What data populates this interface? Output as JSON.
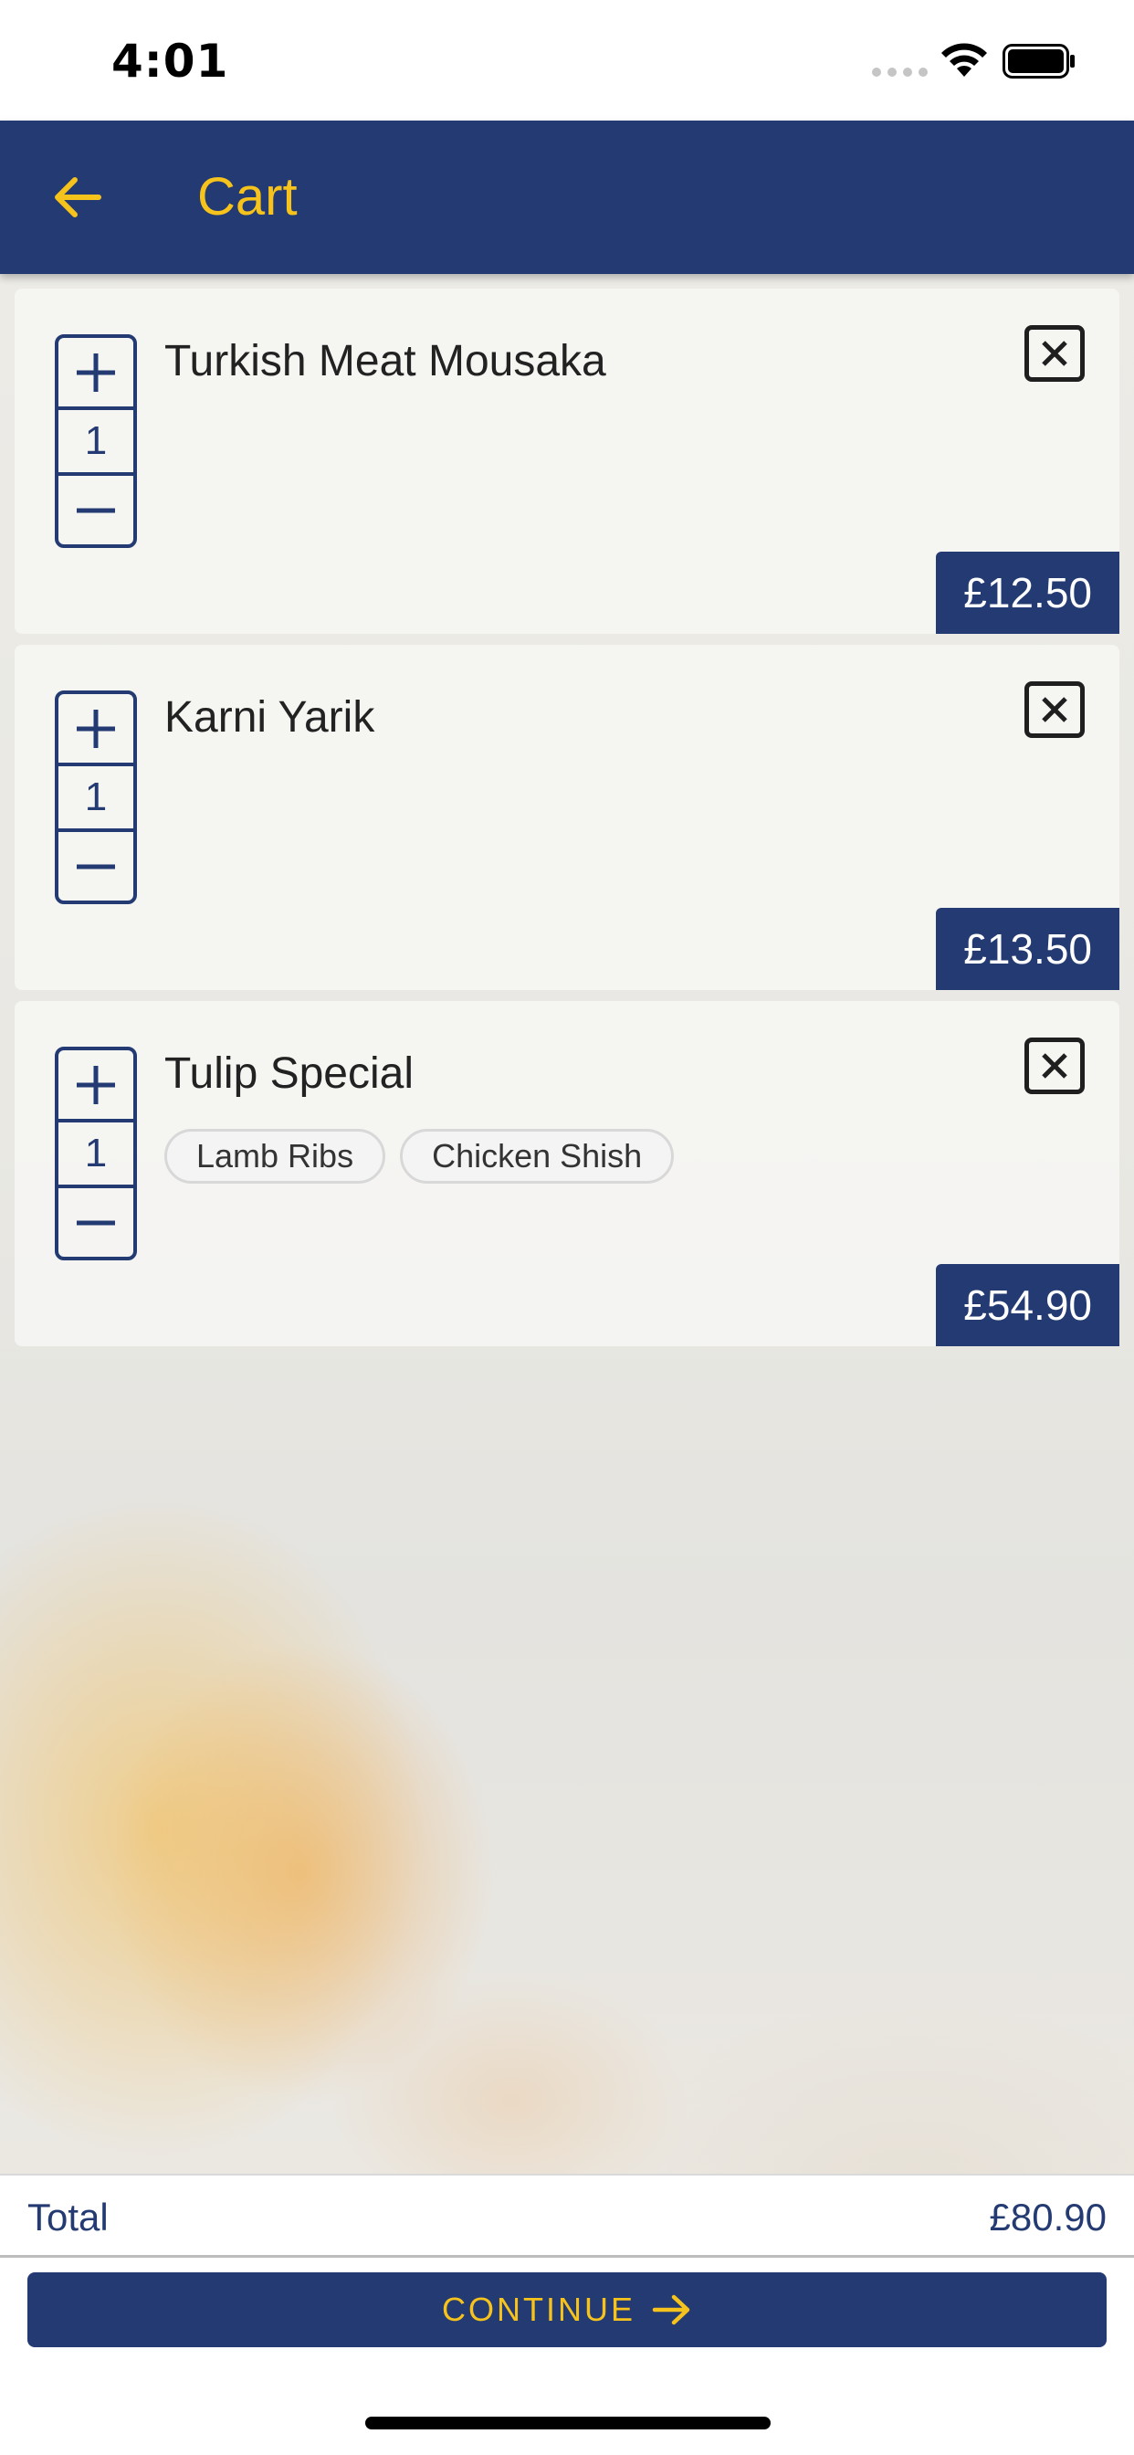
{
  "status_bar": {
    "time": "4:01"
  },
  "header": {
    "title": "Cart"
  },
  "cart": {
    "items": [
      {
        "name": "Turkish Meat Mousaka",
        "quantity": "1",
        "price": "£12.50",
        "tags": []
      },
      {
        "name": "Karni Yarik",
        "quantity": "1",
        "price": "£13.50",
        "tags": []
      },
      {
        "name": "Tulip Special",
        "quantity": "1",
        "price": "£54.90",
        "tags": [
          "Lamb Ribs",
          "Chicken Shish"
        ]
      }
    ]
  },
  "footer": {
    "total_label": "Total",
    "total_value": "£80.90",
    "continue_label": "CONTINUE"
  },
  "colors": {
    "primary": "#243a72",
    "accent": "#f6c21c"
  }
}
